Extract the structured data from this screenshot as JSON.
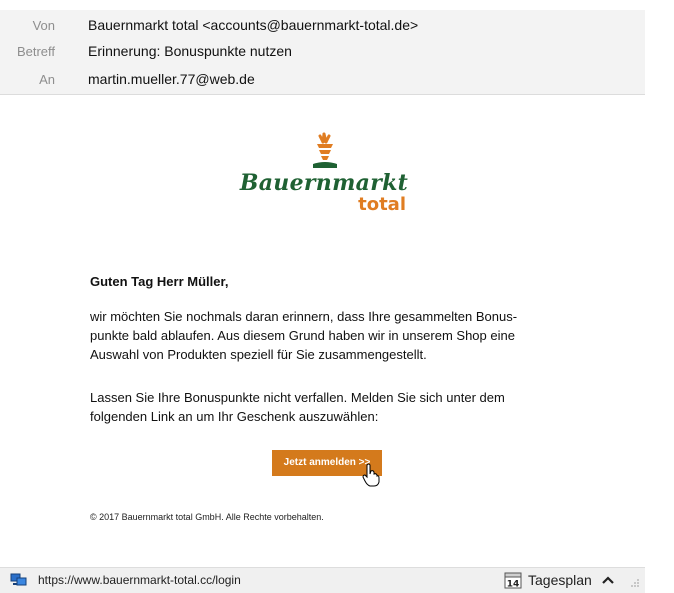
{
  "header": {
    "from_label": "Von",
    "from_value": "Bauernmarkt total <accounts@bauernmarkt-total.de>",
    "subject_label": "Betreff",
    "subject_value": "Erinnerung: Bonuspunkte nutzen",
    "to_label": "An",
    "to_value": "martin.mueller.77@web.de"
  },
  "logo": {
    "line1": "Bauernmarkt",
    "line2": "total",
    "colors": {
      "green": "#1f6133",
      "orange": "#e07d22"
    }
  },
  "body": {
    "greeting": "Guten Tag Herr Müller,",
    "paragraph1": [
      "wir möchten Sie nochmals daran erinnern, dass Ihre gesammelten Bonus-",
      "punkte bald ablaufen. Aus diesem Grund haben wir in unserem Shop eine",
      "Auswahl von Produkten speziell für Sie zusammengestellt."
    ],
    "paragraph2": [
      "Lassen Sie Ihre Bonuspunkte nicht verfallen. Melden Sie sich unter dem",
      "folgenden Link an um Ihr Geschenk auszuwählen:"
    ],
    "cta_label": "Jetzt anmelden >>",
    "cta_color": "#d47a1c",
    "footer": "© 2017 Bauernmarkt total GmbH. Alle Rechte vorbehalten."
  },
  "statusbar": {
    "url": "https://www.bauernmarkt-total.cc/login",
    "calendar_day": "14",
    "tagesplan_label": "Tagesplan",
    "icons": [
      "network-icon",
      "calendar-icon",
      "chevron-up-icon",
      "resize-grip-icon"
    ]
  }
}
